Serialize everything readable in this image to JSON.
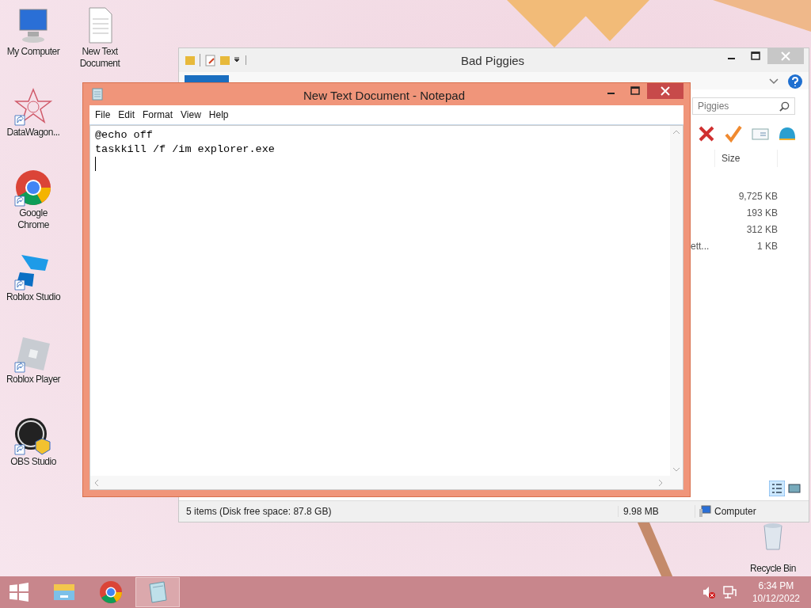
{
  "desktop_icons": [
    {
      "label": "My Computer",
      "kind": "computer",
      "shortcut": false
    },
    {
      "label": "New Text Document",
      "kind": "textfile",
      "shortcut": false
    },
    {
      "label": "DataWagon...",
      "kind": "star",
      "shortcut": true
    },
    {
      "label": "Google Chrome",
      "kind": "chrome",
      "shortcut": true
    },
    {
      "label": "Roblox Studio",
      "kind": "studio",
      "shortcut": true
    },
    {
      "label": "Roblox Player",
      "kind": "player",
      "shortcut": true
    },
    {
      "label": "OBS Studio",
      "kind": "obs",
      "shortcut": true
    },
    {
      "label": "Recycle Bin",
      "kind": "bin",
      "shortcut": false
    }
  ],
  "explorer": {
    "title": "Bad Piggies",
    "search": {
      "placeholder": "Piggies"
    },
    "columns": [
      "Size"
    ],
    "rows": [
      {
        "size": "9,725 KB"
      },
      {
        "size": "193 KB"
      },
      {
        "size": "312 KB"
      },
      {
        "name": "ett...",
        "size": "1 KB"
      }
    ],
    "status": {
      "items": "5 items (Disk free space: 87.8 GB)",
      "size": "9.98 MB",
      "location": "Computer"
    },
    "views": [
      {
        "kind": "details",
        "selected": true
      },
      {
        "kind": "tiles",
        "selected": false
      }
    ]
  },
  "notepad": {
    "title": "New Text Document - Notepad",
    "menu": [
      "File",
      "Edit",
      "Format",
      "View",
      "Help"
    ],
    "lines": [
      "@echo off",
      "taskkill /f /im explorer.exe"
    ]
  },
  "taskbar": {
    "apps": [
      {
        "kind": "explorer",
        "selected": false
      },
      {
        "kind": "chrome",
        "selected": false
      },
      {
        "kind": "notepad",
        "selected": true
      }
    ],
    "time": "6:34 PM",
    "date": "10/12/2022",
    "muted": true
  }
}
